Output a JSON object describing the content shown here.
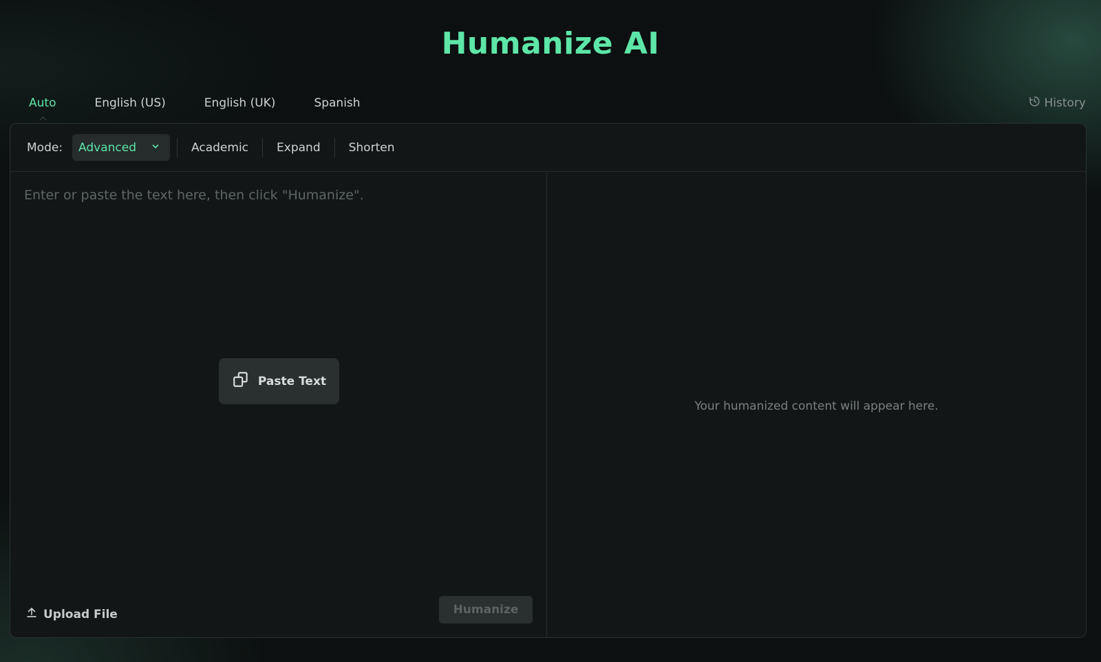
{
  "header": {
    "title": "Humanize AI"
  },
  "language_tabs": [
    {
      "label": "Auto",
      "active": true
    },
    {
      "label": "English (US)",
      "active": false
    },
    {
      "label": "English (UK)",
      "active": false
    },
    {
      "label": "Spanish",
      "active": false
    }
  ],
  "history": {
    "label": "History",
    "icon": "history-icon"
  },
  "mode_bar": {
    "label": "Mode:",
    "selected": "Advanced",
    "options": [
      "Academic",
      "Expand",
      "Shorten"
    ]
  },
  "input": {
    "placeholder": "Enter or paste the text here, then click \"Humanize\".",
    "paste_label": "Paste Text",
    "upload_label": "Upload File",
    "humanize_label": "Humanize"
  },
  "output": {
    "placeholder": "Your humanized content will appear here."
  },
  "colors": {
    "accent": "#5de6a8",
    "panel": "#121617",
    "background": "#0c1010"
  }
}
